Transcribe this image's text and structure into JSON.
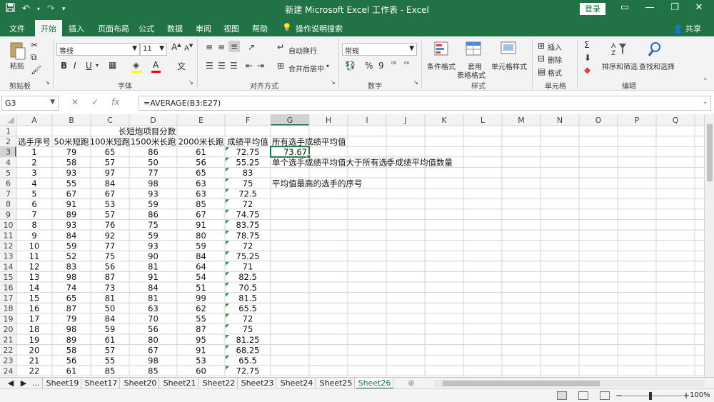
{
  "window": {
    "title": "新建 Microsoft Excel 工作表 - Excel",
    "login_label": "登录",
    "undo_icon": "undo-icon",
    "redo_icon": "redo-icon"
  },
  "tabs": [
    "文件",
    "开始",
    "插入",
    "页面布局",
    "公式",
    "数据",
    "审阅",
    "视图",
    "帮助",
    "操作说明搜索"
  ],
  "active_tab": "开始",
  "share_label": "共享",
  "ribbon": {
    "clipboard": {
      "paste": "粘贴",
      "label": "剪贴板"
    },
    "font": {
      "name": "等线",
      "size": "11",
      "label": "字体",
      "bold": "B",
      "italic": "I",
      "underline": "U"
    },
    "alignment": {
      "wrap": "自动换行",
      "merge": "合并后居中",
      "label": "对齐方式"
    },
    "number": {
      "format": "常规",
      "percent": "%",
      "comma": "9",
      "label": "数字"
    },
    "styles": {
      "conditional": "条件格式",
      "table_line1": "套用",
      "table_line2": "表格格式",
      "cell_styles": "单元格样式",
      "label": "样式"
    },
    "cells": {
      "insert": "插入",
      "delete": "删除",
      "format": "格式",
      "label": "单元格"
    },
    "editing": {
      "sort": "排序和筛选",
      "find": "查找和选择",
      "label": "编辑"
    }
  },
  "formula_bar": {
    "cell": "G3",
    "formula": "=AVERAGE(B3:E27)",
    "fx": "fx"
  },
  "columns": [
    "A",
    "B",
    "C",
    "D",
    "E",
    "F",
    "G",
    "H",
    "I",
    "J",
    "K",
    "L",
    "M",
    "N",
    "O",
    "P",
    "Q"
  ],
  "row_numbers": [
    "1",
    "2",
    "3",
    "4",
    "5",
    "6",
    "7",
    "8",
    "9",
    "10",
    "11",
    "12",
    "13",
    "14",
    "15",
    "16",
    "17",
    "18",
    "19",
    "20",
    "21",
    "22",
    "23",
    "24"
  ],
  "sheet": {
    "title": "长短炮项目分数",
    "headers": [
      "选手序号",
      "50米短跑",
      "100米短跑",
      "1500米长跑",
      "2000米长跑",
      "成绩平均值"
    ],
    "rows": [
      [
        "1",
        "79",
        "65",
        "86",
        "61",
        "72.75"
      ],
      [
        "2",
        "58",
        "57",
        "50",
        "56",
        "55.25"
      ],
      [
        "3",
        "93",
        "97",
        "77",
        "65",
        "83"
      ],
      [
        "4",
        "55",
        "84",
        "98",
        "63",
        "75"
      ],
      [
        "5",
        "67",
        "67",
        "93",
        "63",
        "72.5"
      ],
      [
        "6",
        "91",
        "53",
        "59",
        "85",
        "72"
      ],
      [
        "7",
        "89",
        "57",
        "86",
        "67",
        "74.75"
      ],
      [
        "8",
        "93",
        "76",
        "75",
        "91",
        "83.75"
      ],
      [
        "9",
        "84",
        "92",
        "59",
        "80",
        "78.75"
      ],
      [
        "10",
        "59",
        "77",
        "93",
        "59",
        "72"
      ],
      [
        "11",
        "52",
        "75",
        "90",
        "84",
        "75.25"
      ],
      [
        "12",
        "83",
        "56",
        "81",
        "64",
        "71"
      ],
      [
        "13",
        "98",
        "87",
        "91",
        "54",
        "82.5"
      ],
      [
        "14",
        "74",
        "73",
        "84",
        "51",
        "70.5"
      ],
      [
        "15",
        "65",
        "81",
        "81",
        "99",
        "81.5"
      ],
      [
        "16",
        "87",
        "50",
        "63",
        "62",
        "65.5"
      ],
      [
        "17",
        "79",
        "84",
        "70",
        "55",
        "72"
      ],
      [
        "18",
        "98",
        "59",
        "56",
        "87",
        "75"
      ],
      [
        "19",
        "89",
        "61",
        "80",
        "95",
        "81.25"
      ],
      [
        "20",
        "58",
        "57",
        "67",
        "91",
        "68.25"
      ],
      [
        "21",
        "56",
        "55",
        "98",
        "53",
        "65.5"
      ],
      [
        "22",
        "61",
        "85",
        "85",
        "60",
        "72.75"
      ]
    ],
    "g2": "所有选手成绩平均值",
    "g3": "73.67",
    "g4": "单个选手成绩平均值大于所有选手成绩平均值数量",
    "g6": "平均值最高的选手的序号"
  },
  "sheet_tabs": [
    "...",
    "Sheet19",
    "Sheet17",
    "Sheet20",
    "Sheet21",
    "Sheet22",
    "Sheet23",
    "Sheet24",
    "Sheet25",
    "Sheet26"
  ],
  "active_sheet": "Sheet26",
  "zoom": "100%",
  "colors": {
    "excel_green": "#217346",
    "grid": "#d4d4d4",
    "header_bg": "#f3f3f3"
  }
}
